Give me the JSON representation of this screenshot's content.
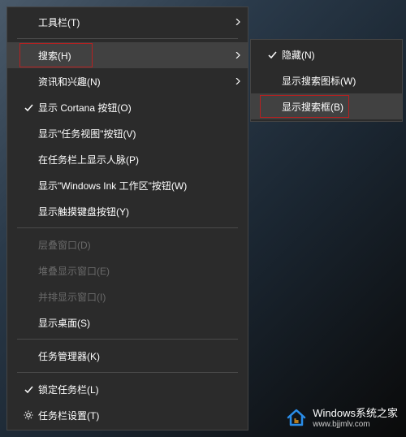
{
  "main_menu": {
    "toolbars": "工具栏(T)",
    "search": "搜索(H)",
    "news_interests": "资讯和兴趣(N)",
    "cortana": "显示 Cortana 按钮(O)",
    "task_view": "显示\"任务视图\"按钮(V)",
    "people": "在任务栏上显示人脉(P)",
    "ink": "显示\"Windows Ink 工作区\"按钮(W)",
    "touch_keyboard": "显示触摸键盘按钮(Y)",
    "cascade": "层叠窗口(D)",
    "stacked": "堆叠显示窗口(E)",
    "side_by_side": "并排显示窗口(I)",
    "show_desktop": "显示桌面(S)",
    "task_manager": "任务管理器(K)",
    "lock_taskbar": "锁定任务栏(L)",
    "taskbar_settings": "任务栏设置(T)"
  },
  "submenu": {
    "hidden": "隐藏(N)",
    "show_icon": "显示搜索图标(W)",
    "show_box": "显示搜索框(B)"
  },
  "watermark": {
    "brand_win": "Windows",
    "brand_cn": "系统之家",
    "url": "www.bjjmlv.com"
  }
}
